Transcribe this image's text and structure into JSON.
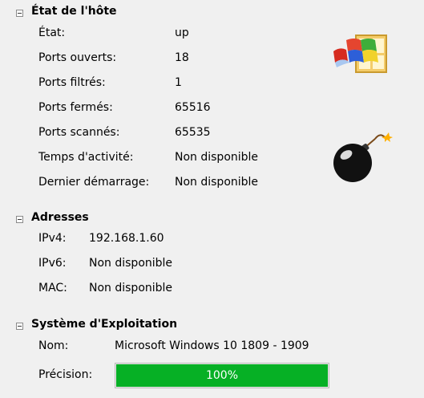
{
  "host_state": {
    "title": "État de l'hôte",
    "rows": [
      {
        "label": "État:",
        "value": "up"
      },
      {
        "label": "Ports ouverts:",
        "value": "18"
      },
      {
        "label": "Ports filtrés:",
        "value": "1"
      },
      {
        "label": "Ports fermés:",
        "value": "65516"
      },
      {
        "label": "Ports scannés:",
        "value": "65535"
      },
      {
        "label": "Temps d'activité:",
        "value": "Non disponible"
      },
      {
        "label": "Dernier démarrage:",
        "value": "Non disponible"
      }
    ],
    "icons": [
      "windows-logo-icon",
      "bomb-icon"
    ]
  },
  "addresses": {
    "title": "Adresses",
    "rows": [
      {
        "label": "IPv4:",
        "value": "192.168.1.60"
      },
      {
        "label": "IPv6:",
        "value": "Non disponible"
      },
      {
        "label": "MAC:",
        "value": "Non disponible"
      }
    ]
  },
  "os": {
    "title": "Système d'Exploitation",
    "name_label": "Nom:",
    "name_value": "Microsoft Windows 10 1809 - 1909",
    "precision_label": "Précision:",
    "precision_text": "100%",
    "precision_fraction": 1.0
  },
  "colors": {
    "progress_fill": "#06b025",
    "background": "#f0f0f0"
  }
}
